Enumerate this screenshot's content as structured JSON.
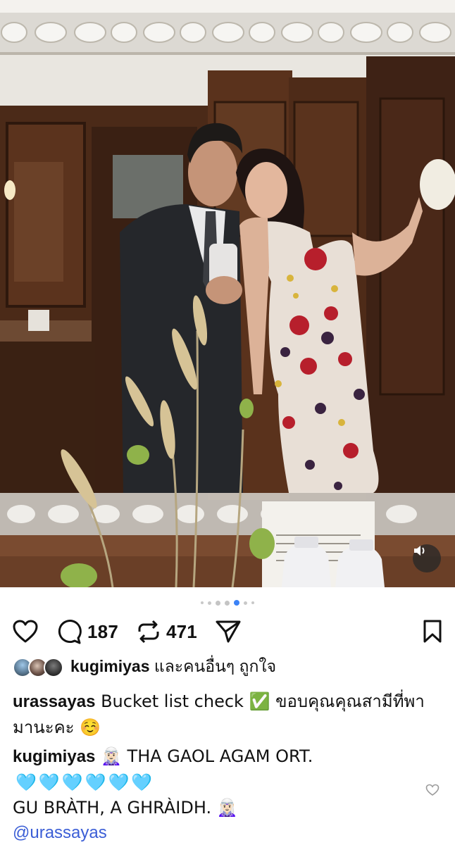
{
  "post": {
    "media": {
      "carousel_total": 7,
      "carousel_active": 4,
      "sound_icon": "speaker-icon"
    },
    "actions": {
      "like_icon": "heart-icon",
      "comment_icon": "comment-bubble-icon",
      "comment_count": "187",
      "repost_icon": "repost-icon",
      "repost_count": "471",
      "share_icon": "send-icon",
      "save_icon": "bookmark-icon"
    },
    "likes": {
      "user": "kugimiyas",
      "text": " และคนอื่นๆ ถูกใจ"
    },
    "caption": {
      "user": "urassayas",
      "text": " Bucket list check ✅ ขอบคุณคุณสามีที่พามานะคะ ☺️"
    },
    "comment": {
      "user": "kugimiyas",
      "line1": " 🧝🏻‍♀️ THA GAOL AGAM ORT.",
      "hearts": "🩵🩵🩵🩵🩵🩵",
      "line2": "GU BRÀTH, A GHRÀIDH. 🧝🏻‍♀️",
      "mention": "@urassayas",
      "like_icon": "small-heart-icon"
    }
  }
}
